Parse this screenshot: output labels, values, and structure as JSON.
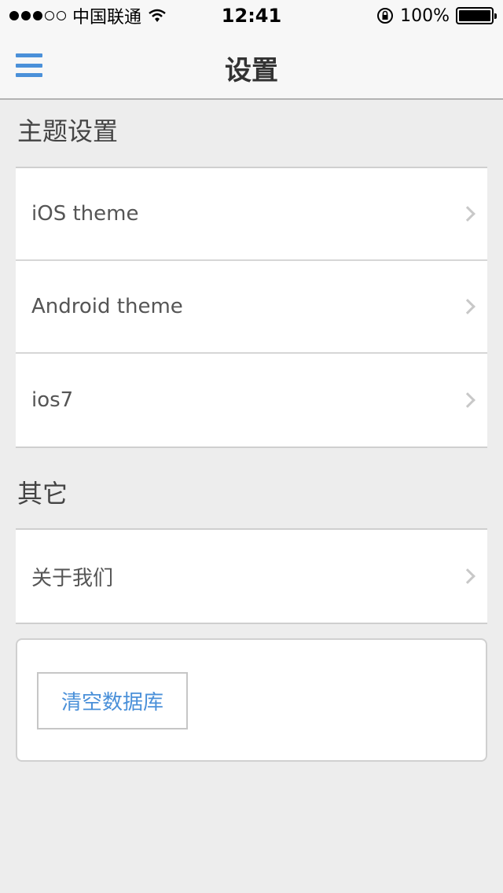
{
  "status_bar": {
    "carrier": "中国联通",
    "time": "12:41",
    "battery": "100%",
    "signal_bars": 3,
    "signal_total": 5
  },
  "nav": {
    "title": "设置",
    "menu_icon": "hamburger-menu-icon",
    "accent_color": "#4a90d9"
  },
  "theme_section": {
    "title": "主题设置",
    "items": [
      {
        "label": "iOS theme"
      },
      {
        "label": "Android theme"
      },
      {
        "label": "ios7"
      }
    ]
  },
  "other_section": {
    "title": "其它",
    "items": [
      {
        "label": "关于我们"
      }
    ]
  },
  "actions": {
    "clear_db_label": "清空数据库"
  }
}
